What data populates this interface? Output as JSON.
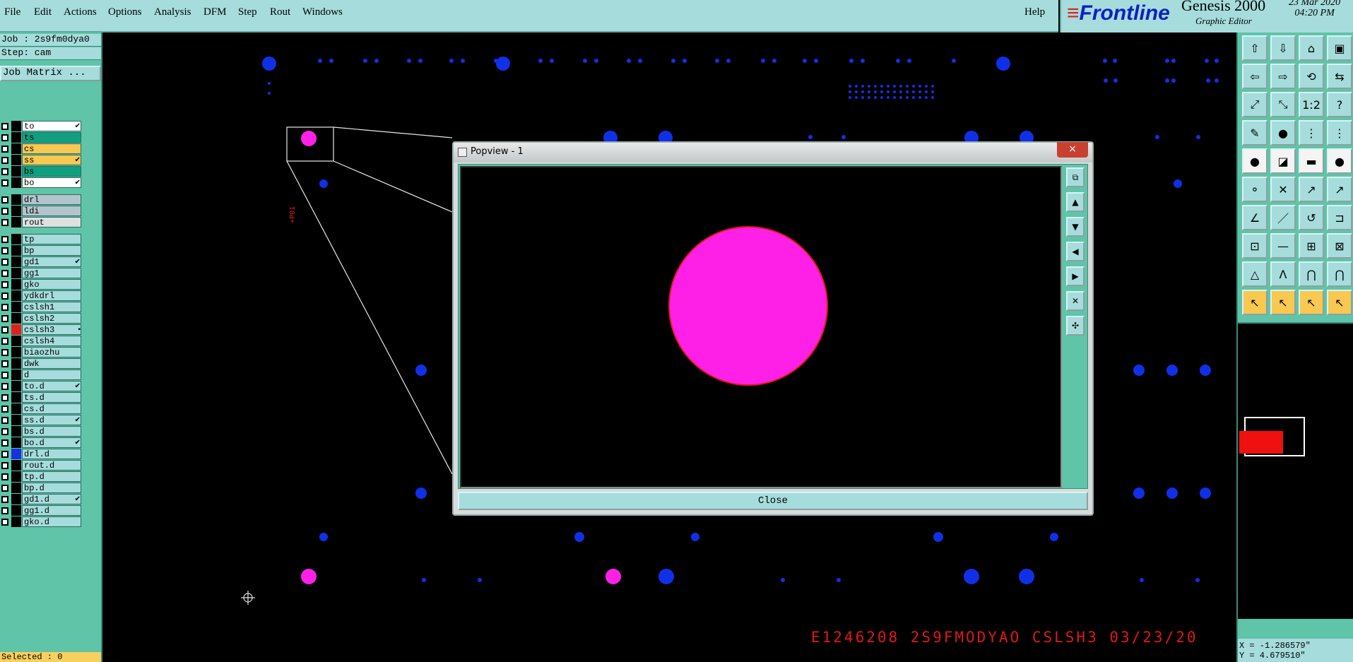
{
  "menubar": {
    "items": [
      "File",
      "Edit",
      "Actions",
      "Options",
      "Analysis",
      "DFM",
      "Step",
      "Rout",
      "Windows"
    ],
    "help": "Help"
  },
  "logo": {
    "brand": "Frontline",
    "product": "Genesis 2000",
    "subtitle": "Graphic Editor",
    "date": "23 Mar 2020",
    "time": "04:20 PM"
  },
  "leftpanel": {
    "job": "Job : 2s9fm0dya0",
    "step": "Step: cam",
    "job_matrix": "Job Matrix ...",
    "selected": "Selected : 0",
    "layers": [
      {
        "name": "to",
        "color": "#ffffff",
        "swatch": "#000000",
        "mark": "✔"
      },
      {
        "name": "ts",
        "color": "#10a080",
        "swatch": "#000000",
        "mark": ""
      },
      {
        "name": "cs",
        "color": "#f8c850",
        "swatch": "#000000",
        "mark": ""
      },
      {
        "name": "ss",
        "color": "#f8c850",
        "swatch": "#000000",
        "mark": "✔"
      },
      {
        "name": "bs",
        "color": "#10a080",
        "swatch": "#000000",
        "mark": ""
      },
      {
        "name": "bo",
        "color": "#ffffff",
        "swatch": "#000000",
        "mark": "✔"
      },
      {
        "name": "drl",
        "color": "#b4c4cc",
        "swatch": "#000000",
        "mark": ""
      },
      {
        "name": "ldi",
        "color": "#b4c4cc",
        "swatch": "#000000",
        "mark": ""
      },
      {
        "name": "rout",
        "color": "#e0e0e0",
        "swatch": "#000000",
        "mark": ""
      },
      {
        "name": "tp",
        "color": "#a6dcdc",
        "swatch": "#000000",
        "mark": ""
      },
      {
        "name": "bp",
        "color": "#a6dcdc",
        "swatch": "#000000",
        "mark": ""
      },
      {
        "name": "gd1",
        "color": "#a6dcdc",
        "swatch": "#000000",
        "mark": "✔"
      },
      {
        "name": "gg1",
        "color": "#a6dcdc",
        "swatch": "#000000",
        "mark": ""
      },
      {
        "name": "gko",
        "color": "#a6dcdc",
        "swatch": "#000000",
        "mark": ""
      },
      {
        "name": "ydkdrl",
        "color": "#a6dcdc",
        "swatch": "#000000",
        "mark": ""
      },
      {
        "name": "cslsh1",
        "color": "#a6dcdc",
        "swatch": "#000000",
        "mark": ""
      },
      {
        "name": "cslsh2",
        "color": "#a6dcdc",
        "swatch": "#000000",
        "mark": ""
      },
      {
        "name": "cslsh3",
        "color": "#a6dcdc",
        "swatch": "#e02020",
        "mark": "▪"
      },
      {
        "name": "cslsh4",
        "color": "#a6dcdc",
        "swatch": "#000000",
        "mark": ""
      },
      {
        "name": "biaozhu",
        "color": "#a6dcdc",
        "swatch": "#000000",
        "mark": ""
      },
      {
        "name": "dwk",
        "color": "#a6dcdc",
        "swatch": "#000000",
        "mark": ""
      },
      {
        "name": "d",
        "color": "#a6dcdc",
        "swatch": "#000000",
        "mark": ""
      },
      {
        "name": "to.d",
        "color": "#a6dcdc",
        "swatch": "#000000",
        "mark": "✔"
      },
      {
        "name": "ts.d",
        "color": "#a6dcdc",
        "swatch": "#000000",
        "mark": ""
      },
      {
        "name": "cs.d",
        "color": "#a6dcdc",
        "swatch": "#000000",
        "mark": ""
      },
      {
        "name": "ss.d",
        "color": "#a6dcdc",
        "swatch": "#000000",
        "mark": "✔"
      },
      {
        "name": "bs.d",
        "color": "#a6dcdc",
        "swatch": "#000000",
        "mark": ""
      },
      {
        "name": "bo.d",
        "color": "#a6dcdc",
        "swatch": "#000000",
        "mark": "✔"
      },
      {
        "name": "drl.d",
        "color": "#a6dcdc",
        "swatch": "#1830e0",
        "mark": ""
      },
      {
        "name": "rout.d",
        "color": "#a6dcdc",
        "swatch": "#000000",
        "mark": ""
      },
      {
        "name": "tp.d",
        "color": "#a6dcdc",
        "swatch": "#000000",
        "mark": ""
      },
      {
        "name": "bp.d",
        "color": "#a6dcdc",
        "swatch": "#000000",
        "mark": ""
      },
      {
        "name": "gd1.d",
        "color": "#a6dcdc",
        "swatch": "#000000",
        "mark": "✔"
      },
      {
        "name": "gg1.d",
        "color": "#a6dcdc",
        "swatch": "#000000",
        "mark": ""
      },
      {
        "name": "gko.d",
        "color": "#a6dcdc",
        "swatch": "#000000",
        "mark": ""
      }
    ]
  },
  "popview": {
    "title": "Popview - 1",
    "close_x": "×",
    "close_label": "Close"
  },
  "canvas": {
    "pad_label": "+P01",
    "stamp": "E1246208 2S9FMODYAO CSLSH3 03/23/20"
  },
  "coords": {
    "x": "X = -1.286579\"",
    "y": "Y = 4.679510\""
  },
  "colors": {
    "pad_blue": "#1030e8",
    "pad_magenta": "#ff20e8",
    "stamp_red": "#e01818",
    "panel_teal": "#5fc4a8",
    "button_teal": "#a6dcdc"
  }
}
